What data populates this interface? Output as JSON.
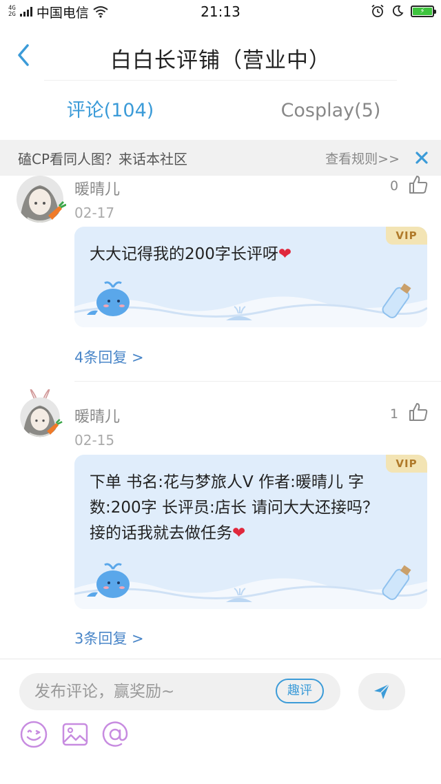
{
  "status_bar": {
    "signal_label_top": "4G",
    "signal_label_bottom": "2G",
    "carrier": "中国电信",
    "time": "21:13"
  },
  "header": {
    "title": "白白长评铺（营业中）"
  },
  "tabs": [
    {
      "label": "评论(104)",
      "active": true
    },
    {
      "label": "Cosplay(5)",
      "active": false
    }
  ],
  "notice": {
    "text": "磕CP看同人图？来话本社区",
    "link": "查看规则>>"
  },
  "comments": [
    {
      "author": "暖晴儿",
      "date": "02-17",
      "likes": "0",
      "badge": "VIP",
      "text": "大大记得我的200字长评呀",
      "replies": "4条回复 >"
    },
    {
      "author": "暖晴儿",
      "date": "02-15",
      "likes": "1",
      "badge": "VIP",
      "text": "下单 书名:花与梦旅人V 作者:暖晴儿 字数:200字 长评员:店长 请问大大还接吗？接的话我就去做任务",
      "replies": "3条回复 >"
    }
  ],
  "composer": {
    "placeholder": "发布评论，赢奖励~",
    "qupin_label": "趣评"
  },
  "icons": {
    "back": "chevron-left-icon",
    "close": "close-icon",
    "like": "thumbs-up-icon",
    "send": "send-icon",
    "emoji": "emoji-icon",
    "image": "image-icon",
    "mention": "at-icon"
  },
  "colors": {
    "accent": "#3b9bd8",
    "bubble": "#e0edfb",
    "vip_bg": "#f3e4b4",
    "vip_text": "#b07a2a",
    "tool_purple": "#c78be0"
  }
}
